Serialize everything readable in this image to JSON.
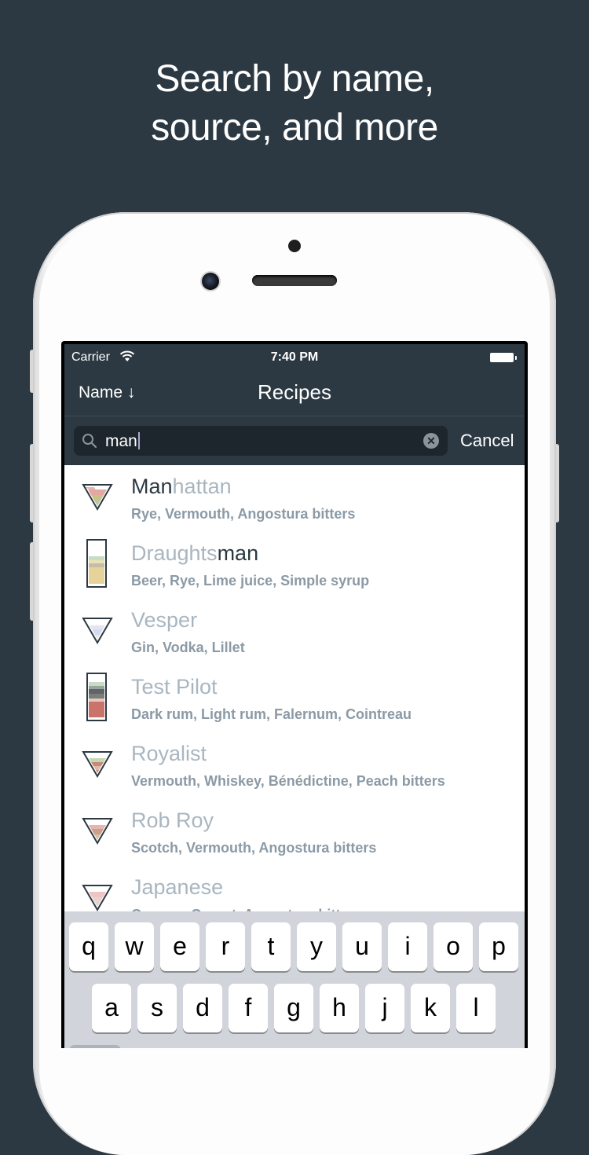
{
  "headline": {
    "line1": "Search by name,",
    "line2": "source, and more"
  },
  "status_bar": {
    "carrier": "Carrier",
    "time": "7:40 PM"
  },
  "nav": {
    "sort_label": "Name ↓",
    "title": "Recipes"
  },
  "search": {
    "value": "man",
    "cancel_label": "Cancel"
  },
  "recipes": [
    {
      "name_match": "Man",
      "name_rest": "hattan",
      "ingredients": "Rye, Vermouth, Angostura bitters"
    },
    {
      "name_pre": "Draughts",
      "name_match": "man",
      "ingredients": "Beer, Rye, Lime juice, Simple syrup"
    },
    {
      "name": "Vesper",
      "ingredients": "Gin, Vodka, Lillet"
    },
    {
      "name": "Test Pilot",
      "ingredients": "Dark rum, Light rum, Falernum, Cointreau"
    },
    {
      "name": "Royalist",
      "ingredients": "Vermouth, Whiskey, Bénédictine, Peach bitters"
    },
    {
      "name": "Rob Roy",
      "ingredients": "Scotch, Vermouth, Angostura bitters"
    },
    {
      "name": "Japanese",
      "ingredients": "Cognac, Orgeat, Angostura bitters"
    }
  ],
  "keyboard": {
    "row1": [
      "q",
      "w",
      "e",
      "r",
      "t",
      "y",
      "u",
      "i",
      "o",
      "p"
    ],
    "row2": [
      "a",
      "s",
      "d",
      "f",
      "g",
      "h",
      "j",
      "k",
      "l"
    ]
  },
  "colors": {
    "background": "#2c3942",
    "match_text": "#2c3942",
    "dim_text": "#a9b6c0",
    "ingredients_text": "#8b9aa6"
  },
  "icons": {
    "search": "search-icon",
    "clear": "clear-icon",
    "wifi": "wifi-icon",
    "battery": "battery-icon",
    "glasses": [
      "cocktail-glass-icon",
      "highball-glass-icon",
      "cocktail-glass-icon",
      "highball-glass-icon",
      "cocktail-glass-icon",
      "cocktail-glass-icon",
      "cocktail-glass-icon"
    ]
  }
}
